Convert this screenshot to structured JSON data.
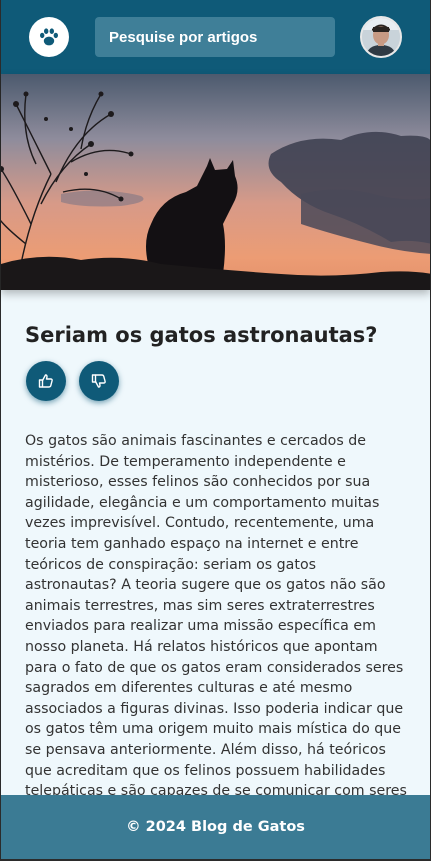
{
  "header": {
    "logo_icon": "paw-icon",
    "search_placeholder": "Pesquise por artigos",
    "avatar_icon": "user-avatar"
  },
  "hero": {
    "image": "cat-silhouette-sunset"
  },
  "article": {
    "title": "Seriam os gatos astronautas?",
    "like_icon": "thumbs-up-icon",
    "dislike_icon": "thumbs-down-icon",
    "body": "Os gatos são animais fascinantes e cercados de mistérios. De temperamento independente e misterioso, esses felinos são conhecidos por sua agilidade, elegância e um comportamento muitas vezes imprevisível. Contudo, recentemente, uma teoria tem ganhado espaço na internet e entre teóricos de conspiração: seriam os gatos astronautas? A teoria sugere que os gatos não são animais terrestres, mas sim seres extraterrestres enviados para realizar uma missão específica em nosso planeta. Há relatos históricos que apontam para o fato de que os gatos eram considerados seres sagrados em diferentes culturas e até mesmo associados a figuras divinas. Isso poderia indicar que os gatos têm uma origem muito mais mística do que se pensava anteriormente. Além disso, há teóricos que acreditam que os felinos possuem habilidades telepáticas e são capazes de se comunicar com seres de outros planetas."
  },
  "footer": {
    "text": "© 2024 Blog de Gatos"
  },
  "colors": {
    "header_bg": "#0f5a78",
    "footer_bg": "#3b7b94",
    "page_bg": "#eff8fc"
  }
}
